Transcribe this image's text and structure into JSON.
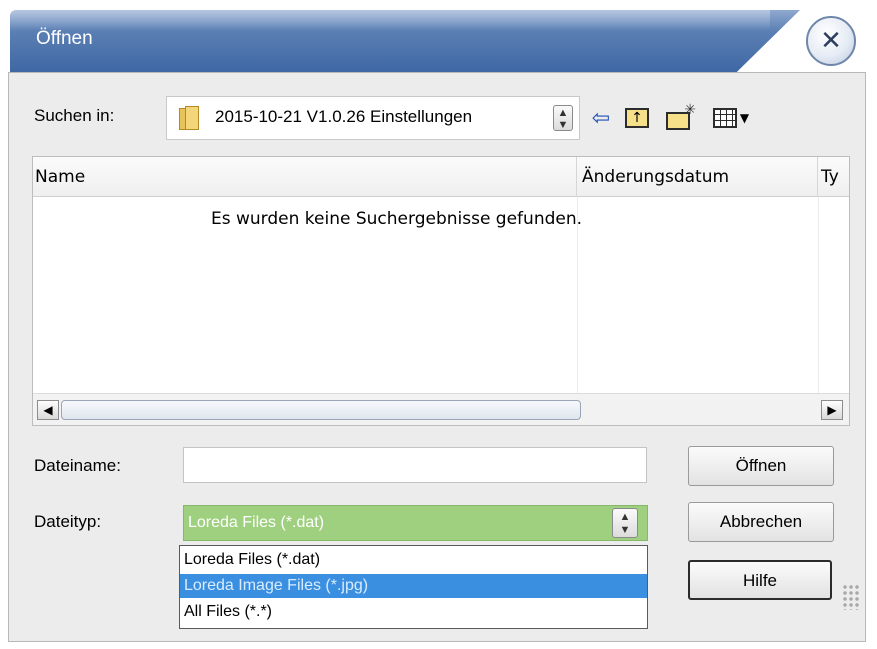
{
  "window": {
    "title": "Öffnen",
    "close_icon": "close-icon"
  },
  "toolbar": {
    "look_in_label": "Suchen in:",
    "look_in_value": "2015-10-21 V1.0.26 Einstellungen",
    "back_icon": "back-arrow-icon",
    "up_icon": "up-folder-icon",
    "new_folder_icon": "new-folder-icon",
    "view_icon": "view-menu-icon"
  },
  "filelist": {
    "columns": [
      "Name",
      "Änderungsdatum",
      "Ty"
    ],
    "empty_message": "Es wurden keine Suchergebnisse gefunden."
  },
  "form": {
    "filename_label": "Dateiname:",
    "filename_value": "",
    "filetype_label": "Dateityp:",
    "filetype_value": "Loreda Files (*.dat)",
    "filetype_options": [
      "Loreda Files (*.dat)",
      "Loreda Image Files (*.jpg)",
      "All Files (*.*)"
    ],
    "highlighted_option": "Loreda Image Files (*.jpg)"
  },
  "buttons": {
    "open": "Öffnen",
    "cancel": "Abbrechen",
    "help": "Hilfe"
  },
  "colors": {
    "title_bar": "#3f67a3",
    "selection": "#3b8fe0",
    "filetype_bg": "#9fd07f"
  }
}
